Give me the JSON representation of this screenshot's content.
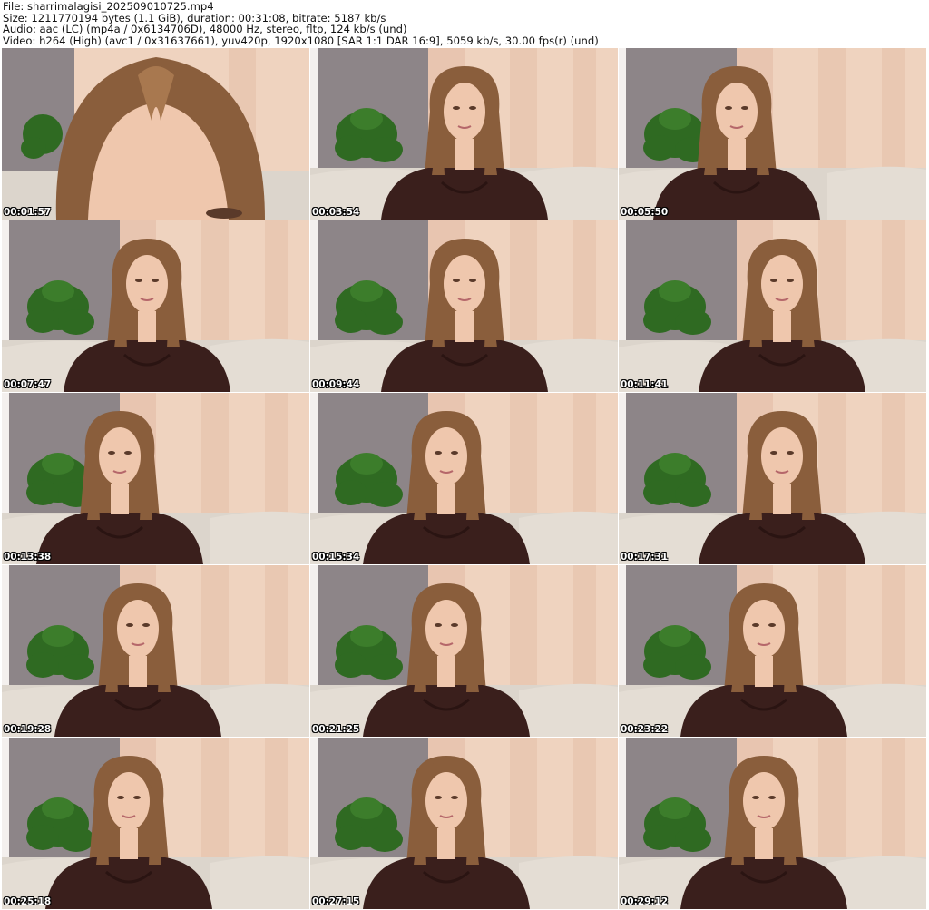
{
  "header": {
    "file": "File: sharrimalagisi_202509010725.mp4",
    "size": "Size: 1211770194 bytes (1.1 GiB), duration: 00:31:08, bitrate: 5187 kb/s",
    "audio": "Audio: aac (LC) (mp4a / 0x6134706D), 48000 Hz, stereo, fltp, 124 kb/s (und)",
    "video": "Video: h264 (High) (avc1 / 0x31637661), yuv420p, 1920x1080 [SAR 1:1 DAR 16:9], 5059 kb/s, 30.00 fps(r) (und)"
  },
  "colors": {
    "curtain": "#efd3bf",
    "curtain_dark": "#e3bda6",
    "wall": "#8d8588",
    "sofa": "#dcd5cc",
    "plant": "#2f6a22",
    "hair": "#8a5e3c",
    "skin": "#efc7ad",
    "top": "#3a1f1c"
  },
  "thumbnails": [
    {
      "timestamp": "00:01:57",
      "shot": "closeup"
    },
    {
      "timestamp": "00:03:54",
      "shot": "medium"
    },
    {
      "timestamp": "00:05:50",
      "shot": "medium"
    },
    {
      "timestamp": "00:07:47",
      "shot": "medium"
    },
    {
      "timestamp": "00:09:44",
      "shot": "medium"
    },
    {
      "timestamp": "00:11:41",
      "shot": "medium"
    },
    {
      "timestamp": "00:13:38",
      "shot": "medium"
    },
    {
      "timestamp": "00:15:34",
      "shot": "medium"
    },
    {
      "timestamp": "00:17:31",
      "shot": "medium"
    },
    {
      "timestamp": "00:19:28",
      "shot": "medium"
    },
    {
      "timestamp": "00:21:25",
      "shot": "medium"
    },
    {
      "timestamp": "00:23:22",
      "shot": "medium"
    },
    {
      "timestamp": "00:25:18",
      "shot": "medium"
    },
    {
      "timestamp": "00:27:15",
      "shot": "medium"
    },
    {
      "timestamp": "00:29:12",
      "shot": "medium"
    }
  ]
}
